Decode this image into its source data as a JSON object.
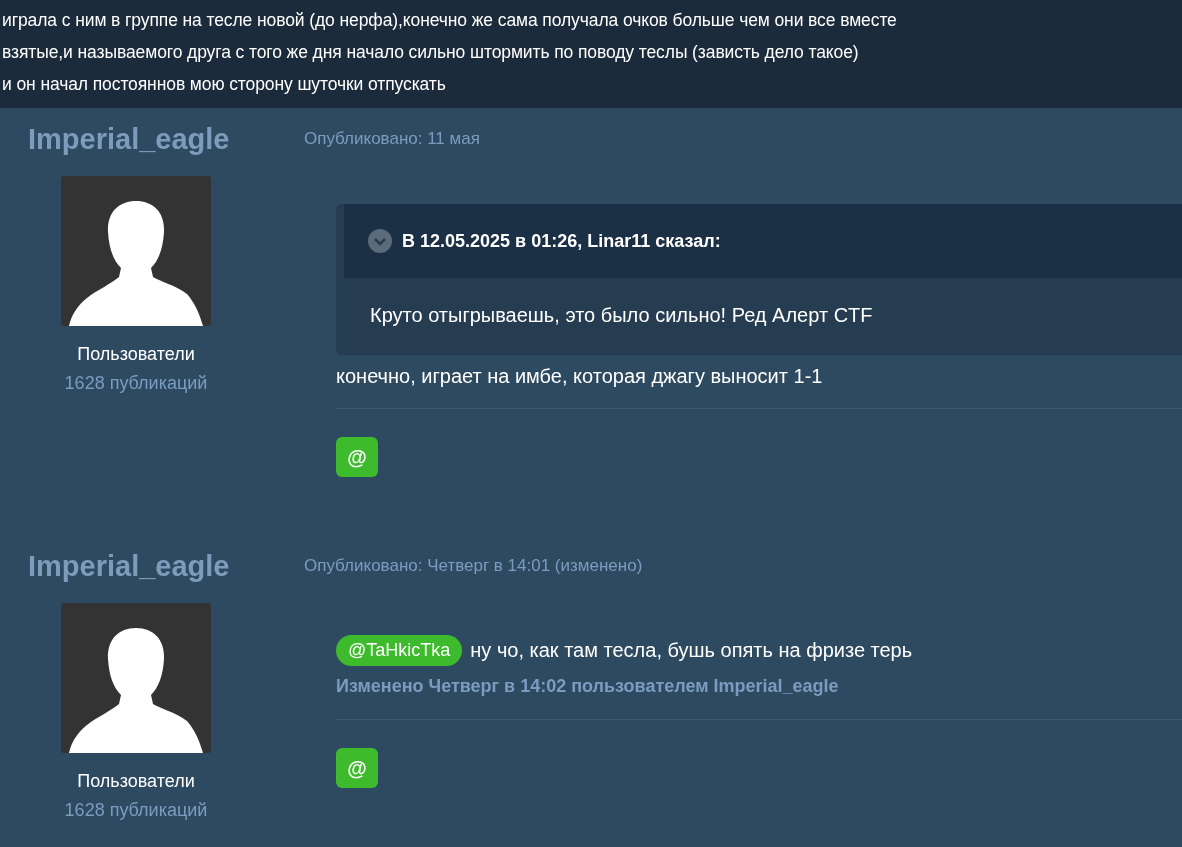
{
  "intro": {
    "lines": [
      "играла с ним в группе на тесле новой (до нерфа),конечно же сама получала очков больше чем они все вместе",
      "взятые,и называемого друга с того же дня начало сильно штормить по поводу теслы (зависть дело такое)",
      "и он начал постояннов  мою сторону шуточки отпускать"
    ]
  },
  "posts": [
    {
      "author": "Imperial_eagle",
      "date": "Опубликовано: 11 мая",
      "group": "Пользователи",
      "count": "1628 публикаций",
      "quote": {
        "header": "В 12.05.2025 в 01:26, Linar11 сказал:",
        "text": "Круто отыгрываешь, это было сильно! Ред Алерт CTF"
      },
      "body": [
        {
          "kind": "text",
          "text": "конечно, играет на имбе, которая джагу выносит 1-1"
        }
      ],
      "mention_button": "@"
    },
    {
      "author": "Imperial_eagle",
      "date": "Опубликовано: Четверг в 14:01 (изменено)",
      "group": "Пользователи",
      "count": "1628 публикаций",
      "body": [
        {
          "kind": "mention",
          "text": "@TaHkicTka"
        },
        {
          "kind": "text",
          "text": "ну чо, как там тесла, бушь опять на фризе терь"
        }
      ],
      "edited": "Изменено Четверг в 14:02 пользователем Imperial_eagle",
      "mention_button": "@"
    }
  ]
}
